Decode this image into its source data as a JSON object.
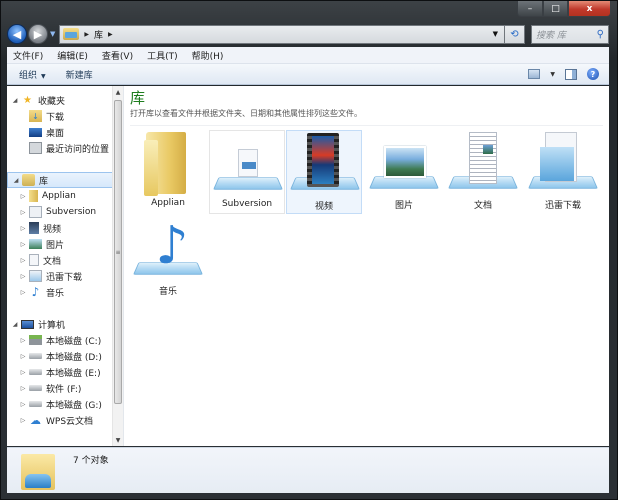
{
  "window": {
    "controls": {
      "minimize": "–",
      "maximize": "□",
      "close": "x"
    }
  },
  "address": {
    "back_icon": "back-arrow-icon",
    "forward_icon": "forward-arrow-icon",
    "breadcrumb": [
      "库"
    ],
    "refresh_icon": "refresh-icon",
    "search_placeholder": "搜索 库",
    "search_icon": "magnifier-icon"
  },
  "menubar": [
    "文件(F)",
    "编辑(E)",
    "查看(V)",
    "工具(T)",
    "帮助(H)"
  ],
  "toolbar": {
    "organize": "组织",
    "new_library": "新建库"
  },
  "sidebar": {
    "favorites": {
      "label": "收藏夹",
      "items": [
        "下载",
        "桌面",
        "最近访问的位置"
      ]
    },
    "libraries": {
      "label": "库",
      "items": [
        "Applian",
        "Subversion",
        "视频",
        "图片",
        "文档",
        "迅雷下载",
        "音乐"
      ]
    },
    "computer": {
      "label": "计算机",
      "items": [
        "本地磁盘 (C:)",
        "本地磁盘 (D:)",
        "本地磁盘 (E:)",
        "软件 (F:)",
        "本地磁盘 (G:)",
        "WPS云文档"
      ]
    }
  },
  "main": {
    "title": "库",
    "description": "打开库以查看文件并根据文件夹、日期和其他属性排列这些文件。",
    "items": [
      {
        "label": "Applian",
        "icon": "folder-icon"
      },
      {
        "label": "Subversion",
        "icon": "library-document-icon"
      },
      {
        "label": "视频",
        "icon": "video-library-icon"
      },
      {
        "label": "图片",
        "icon": "pictures-library-icon"
      },
      {
        "label": "文档",
        "icon": "documents-library-icon"
      },
      {
        "label": "迅雷下载",
        "icon": "downloads-library-icon"
      },
      {
        "label": "音乐",
        "icon": "music-library-icon"
      }
    ]
  },
  "status": {
    "count": "7 个对象"
  }
}
